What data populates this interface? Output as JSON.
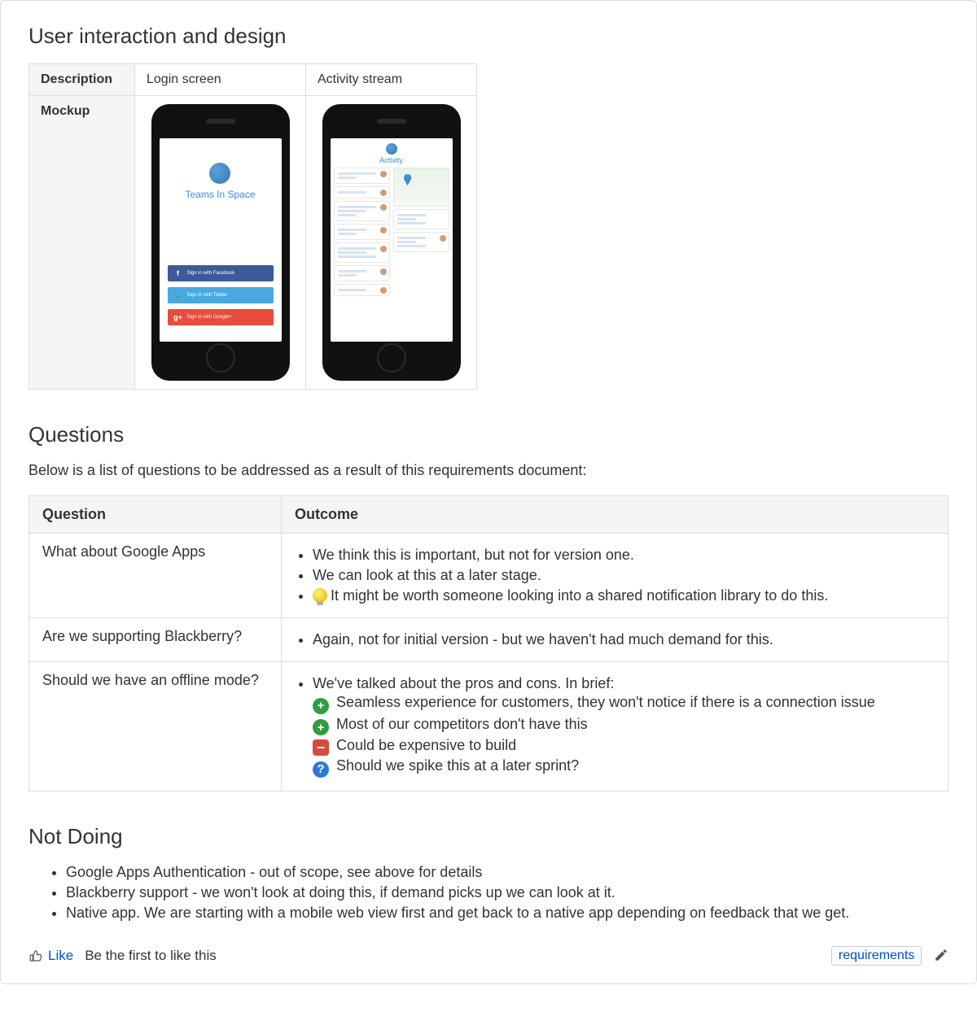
{
  "section1": {
    "title": "User interaction and design",
    "row1_label": "Description",
    "row2_label": "Mockup",
    "col1": "Login screen",
    "col2": "Activity stream",
    "login": {
      "brand": "Teams In Space",
      "fb": "Sign in with Facebook",
      "tw": "Sign in with Twitter",
      "gp": "Sign in with Google+"
    },
    "activity_title": "Activity"
  },
  "questions": {
    "title": "Questions",
    "intro": "Below is a list of questions to be addressed as a result of this requirements document:",
    "head_q": "Question",
    "head_o": "Outcome",
    "rows": [
      {
        "q": "What about Google Apps",
        "o": [
          "We think this is important, but not for version one.",
          "We can look at this at a later stage.",
          "It might be worth someone looking into a shared notification library to do this."
        ],
        "icons": [
          "",
          "",
          "bulb"
        ]
      },
      {
        "q": "Are we supporting Blackberry?",
        "o": [
          "Again, not for initial version - but we haven't had much demand for this."
        ],
        "icons": [
          ""
        ]
      },
      {
        "q": "Should we have an offline mode?",
        "o": [
          "We've talked about the pros and cons. In brief:"
        ],
        "sub": [
          {
            "icon": "plus",
            "text": "Seamless experience for customers, they won't notice if there is a connection issue"
          },
          {
            "icon": "plus",
            "text": "Most of our competitors don't have this"
          },
          {
            "icon": "minus",
            "text": "Could be expensive to build"
          },
          {
            "icon": "qmark",
            "text": "Should we spike this at a later sprint?"
          }
        ]
      }
    ]
  },
  "notdoing": {
    "title": "Not Doing",
    "items": [
      "Google Apps Authentication - out of scope, see above for details",
      "Blackberry support - we won't look at doing this, if demand picks up we can look at it.",
      "Native app. We are starting with a mobile web view first and get back to a native app depending on feedback that we get."
    ]
  },
  "footer": {
    "like": "Like",
    "like_hint": "Be the first to like this",
    "tag": "requirements"
  }
}
